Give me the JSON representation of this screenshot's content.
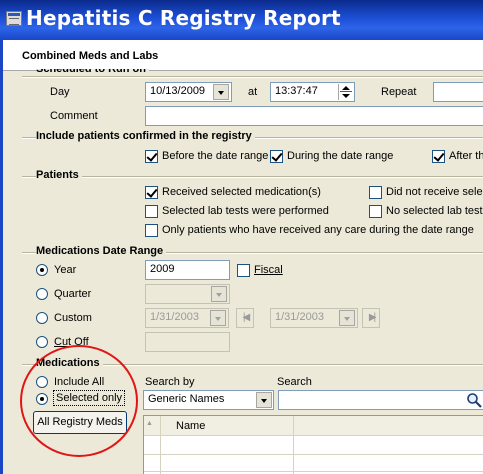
{
  "window": {
    "title": "Hepatitis C Registry Report"
  },
  "header": {
    "report_type": "Combined Meds and Labs"
  },
  "schedule": {
    "group_label_partial": "Scheduled to Run on",
    "day_label": "Day",
    "day_value": "10/13/2009",
    "at_label": "at",
    "time_value": "13:37:47",
    "repeat_label": "Repeat",
    "repeat_value": "",
    "comment_label": "Comment",
    "comment_value": ""
  },
  "confirmed": {
    "group_label": "Include patients confirmed in the registry",
    "before_label": "Before the date range",
    "during_label": "During the date range",
    "after_label": "After th"
  },
  "patients": {
    "group_label": "Patients",
    "received_meds_label": "Received selected medication(s)",
    "not_received_label": "Did not receive selec",
    "labs_performed_label": "Selected lab tests were performed",
    "no_labs_label": "No selected lab tests",
    "only_care_label": "Only patients who have received any care during the date range"
  },
  "date_range": {
    "group_label": "Medications Date Range",
    "year_label": "Year",
    "year_value": "2009",
    "fiscal_label": "Fiscal",
    "quarter_label": "Quarter",
    "quarter_value": "",
    "custom_label": "Custom",
    "custom_start": "1/31/2003",
    "custom_end": "1/31/2003",
    "cutoff_label": "Cut Off",
    "cutoff_value": "",
    "nav_first": "|◀",
    "nav_last": "▶|"
  },
  "medications": {
    "group_label": "Medications",
    "include_all_label": "Include All",
    "selected_only_label": "Selected only",
    "all_registry_button": "All Registry Meds",
    "search_by_label": "Search by",
    "search_by_value": "Generic Names",
    "search_label": "Search",
    "search_value": "",
    "grid_sort_glyph": "▲",
    "grid_column_name": "Name"
  },
  "colors": {
    "titlebar": "#1d4fd6",
    "panel": "#ece9d8",
    "annotation_ring": "#e01616"
  },
  "icons": [
    "app-icon",
    "spin-up-icon",
    "spin-down-icon",
    "chevron-down-icon",
    "magnifier-icon",
    "sort-asc-icon"
  ]
}
